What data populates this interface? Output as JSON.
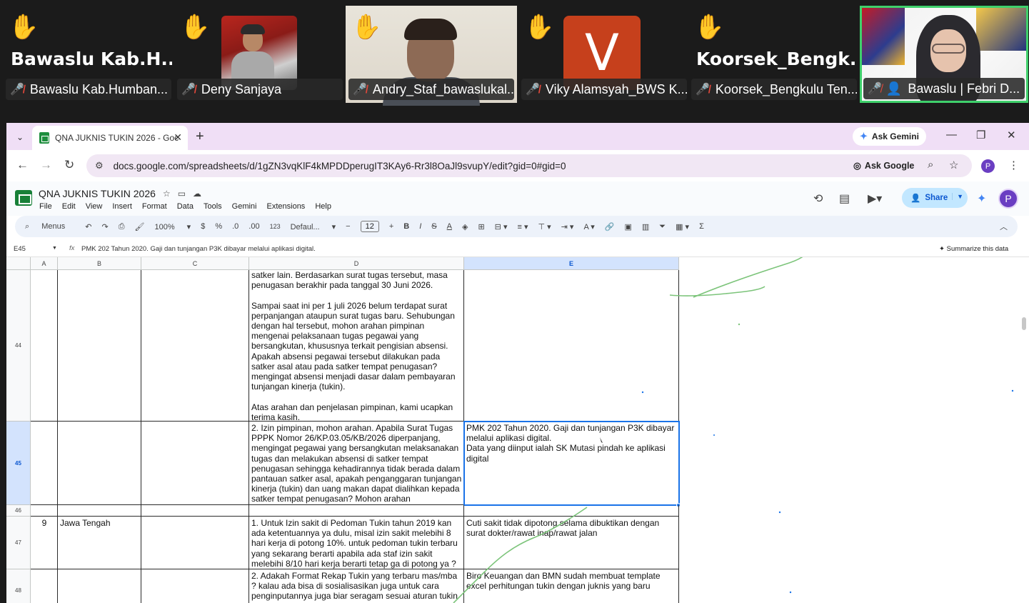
{
  "meeting": {
    "participants": [
      {
        "tile_name": "Bawaslu  Kab.H...",
        "label": "Bawaslu Kab.Humban..."
      },
      {
        "tile_name": "",
        "label": "Deny Sanjaya"
      },
      {
        "tile_name": "",
        "label": "Andry_Staf_bawaslukal..."
      },
      {
        "tile_name": "V",
        "label": "Viky Alamsyah_BWS K..."
      },
      {
        "tile_name": "Koorsek_Bengk...",
        "label": "Koorsek_Bengkulu Ten..."
      },
      {
        "tile_name": "",
        "label": "Bawaslu | Febri D..."
      }
    ],
    "hand_icon": "raised-hand-icon",
    "mic_icon": "mic-muted-icon"
  },
  "browser": {
    "tab_title": "QNA JUKNIS TUKIN 2026 - Goc",
    "ask_gemini": "Ask Gemini",
    "url": "docs.google.com/spreadsheets/d/1gZN3vqKlF4kMPDDperugIT3KAy6-Rr3l8OaJl9svupY/edit?gid=0#gid=0",
    "ask_google": "Ask Google",
    "profile_initial": "P"
  },
  "sheets": {
    "title": "QNA JUKNIS TUKIN 2026",
    "menus": [
      "File",
      "Edit",
      "View",
      "Insert",
      "Format",
      "Data",
      "Tools",
      "Gemini",
      "Extensions",
      "Help"
    ],
    "share_label": "Share",
    "toolbar": {
      "menus_label": "Menus",
      "zoom": "100%",
      "currency": "$",
      "percent": "%",
      "dec_down": ".0",
      "dec_up": ".00",
      "num_format": "123",
      "font": "Defaul...",
      "font_size": "12"
    },
    "cell_ref": "E45",
    "formula_value": "PMK 202 Tahun 2020. Gaji dan tunjangan P3K dibayar melalui aplikasi digital.",
    "summarize_label": "Summarize this data",
    "columns": [
      "A",
      "B",
      "C",
      "D",
      "E"
    ],
    "rows": [
      {
        "num": "44",
        "a": "",
        "b": "",
        "c": "",
        "d": "satker lain. Berdasarkan surat tugas tersebut, masa penugasan berakhir pada tanggal 30 Juni 2026.\n\nSampai saat ini per 1 juli 2026 belum terdapat surat perpanjangan ataupun surat tugas baru. Sehubungan dengan hal tersebut, mohon arahan pimpinan mengenai pelaksanaan tugas pegawai yang bersangkutan, khususnya terkait pengisian absensi. Apakah absensi pegawai tersebut dilakukan pada satker asal atau pada satker tempat penugasan? mengingat absensi menjadi dasar dalam pembayaran tunjangan kinerja (tukin).\n\nAtas arahan dan penjelasan pimpinan, kami ucapkan terima kasih.",
        "e": ""
      },
      {
        "num": "45",
        "a": "",
        "b": "",
        "c": "",
        "d": "2. Izin pimpinan, mohon arahan. Apabila Surat Tugas PPPK Nomor 26/KP.03.05/KB/2026 diperpanjang, mengingat pegawai yang bersangkutan melaksanakan tugas dan melakukan absensi di satker tempat penugasan sehingga kehadirannya tidak berada dalam pantauan satker asal, apakah penganggaran tunjangan kinerja (tukin) dan uang makan dapat dialihkan kepada satker tempat penugasan? Mohon arahan",
        "e": "PMK 202 Tahun 2020. Gaji dan tunjangan P3K dibayar melalui aplikasi digital.\nData yang diinput ialah SK Mutasi pindah ke aplikasi digital"
      },
      {
        "num": "46",
        "a": "",
        "b": "",
        "c": "",
        "d": "",
        "e": ""
      },
      {
        "num": "47",
        "a": "9",
        "b": "Jawa Tengah",
        "c": "",
        "d": "1. Untuk Izin sakit di Pedoman Tukin tahun 2019 kan ada ketentuannya ya dulu, misal izin sakit melebihi 8 hari kerja di potong 10%. untuk pedoman tukin terbaru yang sekarang berarti apabila ada staf izin sakit melebihi 8/10 hari kerja berarti tetap ga di potong ya ?",
        "e": "Cuti sakit tidak dipotong selama dibuktikan dengan surat dokter/rawat inap/rawat jalan"
      },
      {
        "num": "48",
        "a": "",
        "b": "",
        "c": "",
        "d": "2. Adakah Format Rekap Tukin yang terbaru mas/mba ? kalau ada bisa di sosialisasikan juga untuk cara penginputannya juga biar seragam sesuai aturan tukin",
        "e": "Biro Keuangan dan BMN sudah membuat template excel perhitungan tukin dengan juknis yang baru"
      }
    ]
  }
}
